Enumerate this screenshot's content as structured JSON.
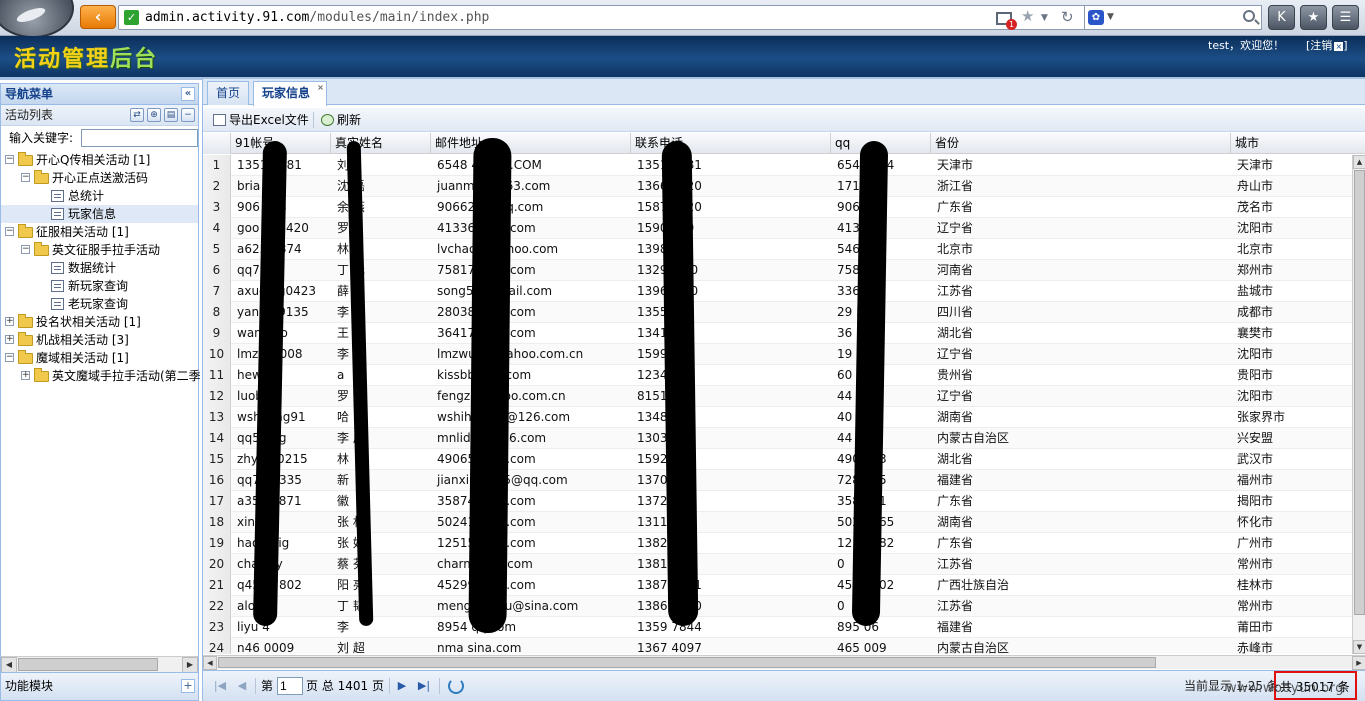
{
  "browser": {
    "back_glyph": "‹",
    "url_host": "admin.activity.91.com",
    "url_path": "/modules/main/index.php",
    "secure_glyph": "✓",
    "notify_count": "1",
    "search_engine_glyph": "✿",
    "buttons": [
      "K",
      "★",
      "☰"
    ]
  },
  "header": {
    "logo_part1": "活动管理",
    "logo_part2": "后台",
    "welcome": "test，欢迎您！",
    "logout": "[注销",
    "logout_x": "×",
    "logout_end": "]"
  },
  "nav": {
    "title": "导航菜单",
    "collapse_glyph": "«",
    "activity_list_label": "活动列表",
    "keyword_label": "输入关键字:",
    "keyword_value": "",
    "tools": [
      "⇄",
      "⊕",
      "▤",
      "−"
    ],
    "tree": [
      {
        "label": "开心Q传相关活动 [1]",
        "level": 0,
        "type": "folder",
        "expander": "−"
      },
      {
        "label": "开心正点送激活码",
        "level": 1,
        "type": "folder",
        "expander": "−"
      },
      {
        "label": "总统计",
        "level": 2,
        "type": "page"
      },
      {
        "label": "玩家信息",
        "level": 2,
        "type": "page",
        "selected": true
      },
      {
        "label": "征服相关活动 [1]",
        "level": 0,
        "type": "folder",
        "expander": "−"
      },
      {
        "label": "英文征服手拉手活动",
        "level": 1,
        "type": "folder",
        "expander": "−"
      },
      {
        "label": "数据统计",
        "level": 2,
        "type": "page"
      },
      {
        "label": "新玩家查询",
        "level": 2,
        "type": "page"
      },
      {
        "label": "老玩家查询",
        "level": 2,
        "type": "page"
      },
      {
        "label": "投名状相关活动 [1]",
        "level": 0,
        "type": "folder",
        "expander": "+"
      },
      {
        "label": "机战相关活动 [3]",
        "level": 0,
        "type": "folder",
        "expander": "+"
      },
      {
        "label": "魔域相关活动 [1]",
        "level": 0,
        "type": "folder",
        "expander": "−"
      },
      {
        "label": "英文魔域手拉手活动(第二季",
        "level": 1,
        "type": "folder",
        "expander": "+"
      }
    ],
    "footer_label": "功能模块",
    "footer_glyph": "+"
  },
  "tabs": [
    {
      "label": "首页",
      "active": false
    },
    {
      "label": "玩家信息",
      "active": true,
      "close": "×"
    }
  ],
  "toolbar": {
    "export_label": "导出Excel文件",
    "refresh_label": "刷新"
  },
  "grid": {
    "columns": [
      "91帐号",
      "真实姓名",
      "邮件地址",
      "联系电话",
      "qq",
      "省份",
      "城市"
    ],
    "rows": [
      [
        "1",
        "1351   6881",
        "刘",
        "6548      4@QQ.COM",
        "1351   6881",
        "654   5334",
        "天津市",
        "天津市"
      ],
      [
        "2",
        "bria     n",
        "沈  磊",
        "juanm     u@163.com",
        "1366    8320",
        "171     916",
        "浙江省",
        "舟山市"
      ],
      [
        "3",
        "906     318",
        "余  燕",
        "90662    8@qq.com",
        "1587    8720",
        "906     318",
        "广东省",
        "茂名市"
      ],
      [
        "4",
        "goo     336420",
        "罗",
        "41336      @qq.com",
        "1590    999",
        "413     20",
        "辽宁省",
        "沈阳市"
      ],
      [
        "5",
        "a625    4874",
        "林",
        "lvchao      @yahoo.com",
        "1398    58",
        "546     752",
        "北京市",
        "北京市"
      ],
      [
        "6",
        "qq7",
        "丁  元",
        "75817      @qq.com",
        "1329   0  90",
        "758     71",
        "河南省",
        "郑州市"
      ],
      [
        "7",
        "axue     ng0423",
        "薛",
        "song5     hotmail.com",
        "1396    0  10",
        "336     6",
        "江苏省",
        "盐城市"
      ],
      [
        "8",
        "yang    29135",
        "李",
        "28038      @qq.com",
        "1355       44",
        "29     5",
        "四川省",
        "成都市"
      ],
      [
        "9",
        "wan      hao",
        "王  路",
        "36417      @qq.com",
        "1341     85",
        "36     195",
        "湖北省",
        "襄樊市"
      ],
      [
        "10",
        "lmzw    2008",
        "李  荆",
        "lmzwu    3@yahoo.com.cn",
        "1599    07",
        "19     613",
        "辽宁省",
        "沈阳市"
      ],
      [
        "11",
        "hew    0",
        "a",
        "kissbb     163.com",
        "1234    31",
        "60     0",
        "贵州省",
        "贵阳市"
      ],
      [
        "12",
        "luob",
        "罗  娜",
        "fengzh     yahoo.com.cn",
        "8151",
        "44     29",
        "辽宁省",
        "沈阳市"
      ],
      [
        "13",
        "wshi    ong91",
        "哈",
        "wshihe    520@126.com",
        "1348     957",
        "40     012",
        "湖南省",
        "张家界市"
      ],
      [
        "14",
        "qq52   ng",
        "李  成",
        "mnlida      @126.com",
        "1303     585",
        "44     34",
        "内蒙古自治区",
        "兴安盟"
      ],
      [
        "15",
        "zhyu    10215",
        "林",
        "49065      @qq.com",
        "1592     860",
        "490     153",
        "湖北省",
        "武汉市"
      ],
      [
        "16",
        "qq72   3335",
        "  新",
        "jianxin     3335@qq.com",
        "1370     300",
        "728     335",
        "福建省",
        "福州市"
      ],
      [
        "17",
        "a358   4871",
        "  徽",
        "35874      @qq.com",
        "1372     920",
        "358     871",
        "广东省",
        "揭阳市"
      ],
      [
        "18",
        "xinc    i",
        "张  林",
        "50241      @qq.com",
        "1311     055",
        "502     7865",
        "湖南省",
        "怀化市"
      ],
      [
        "19",
        "haoh    big",
        "张  好",
        "12515      @qq.com",
        "1382     091",
        "125     2082",
        "广东省",
        "广州市"
      ],
      [
        "20",
        "char    iry",
        "蔡  芬",
        "charm     sina.com",
        "1381     704",
        "0",
        "江苏省",
        "常州市"
      ],
      [
        "21",
        "q452   7802",
        "阳  亮",
        "45299      @qq.com",
        "1387     6421",
        "452     7802",
        "广西壮族自治",
        "桂林市"
      ],
      [
        "22",
        "aloo",
        "丁  韬",
        "meng     ongyu@sina.com",
        "1386     5110",
        "0",
        "江苏省",
        "常州市"
      ],
      [
        "23",
        "liyu    4",
        "李",
        "8954     qq.com",
        "1359     7844",
        "895     06",
        "福建省",
        "莆田市"
      ],
      [
        "24",
        "n46    0009",
        "刘  超",
        "nma      sina.com",
        "1367     4097",
        "465     009",
        "内蒙古自治区",
        "赤峰市"
      ]
    ]
  },
  "pager": {
    "page_prefix": "第",
    "page_value": "1",
    "page_total": "页 总 1401 页",
    "display_info": "当前显示 1-25 条",
    "total": "共 35017 条"
  },
  "watermark": "www.wooyun.org"
}
